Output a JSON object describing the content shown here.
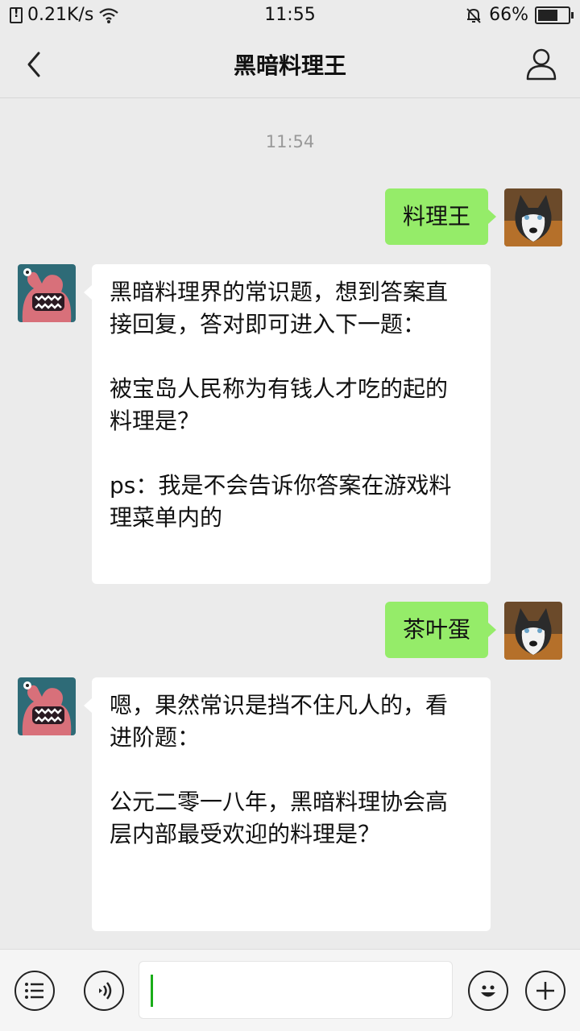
{
  "status_bar": {
    "network_speed": "0.21K/s",
    "time": "11:55",
    "battery_percent": "66%",
    "battery_level": 0.66,
    "icons": [
      "sim-alert-icon",
      "wifi-icon",
      "mute-bell-icon",
      "battery-icon"
    ]
  },
  "header": {
    "title": "黑暗料理王",
    "back_icon": "chevron-left-icon",
    "profile_icon": "person-icon"
  },
  "chat": {
    "timestamp": "11:54",
    "messages": [
      {
        "direction": "out",
        "text": "料理王",
        "avatar": "husky-dog-avatar"
      },
      {
        "direction": "in",
        "avatar": "octopus-monster-avatar",
        "lines": [
          "黑暗料理界的常识题，想到答案直",
          "接回复，答对即可进入下一题：",
          "",
          "被宝岛人民称为有钱人才吃的起的",
          "料理是？",
          "",
          "ps：我是不会告诉你答案在游戏料",
          "理菜单内的"
        ]
      },
      {
        "direction": "out",
        "text": "茶叶蛋",
        "avatar": "husky-dog-avatar"
      },
      {
        "direction": "in",
        "avatar": "octopus-monster-avatar",
        "lines": [
          "嗯，果然常识是挡不住凡人的，看",
          "进阶题：",
          "",
          "公元二零一八年，黑暗料理协会高",
          "层内部最受欢迎的料理是？"
        ]
      }
    ]
  },
  "input_bar": {
    "menu_icon": "list-menu-icon",
    "voice_icon": "voice-icon",
    "input_value": "",
    "emoji_icon": "emoji-icon",
    "add_icon": "plus-icon"
  },
  "colors": {
    "background": "#ebebeb",
    "outgoing_bubble": "#95ec69",
    "incoming_bubble": "#ffffff",
    "caret": "#1aad19"
  }
}
